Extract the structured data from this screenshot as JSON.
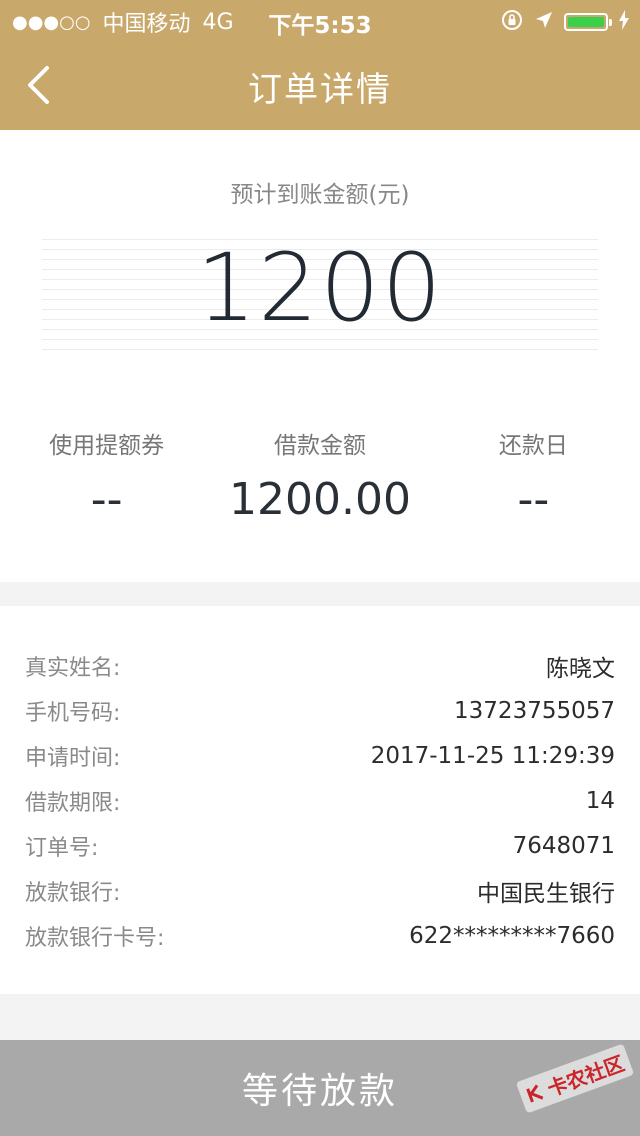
{
  "status_bar": {
    "signal_dots": "●●●○○",
    "carrier": "中国移动",
    "network": "4G",
    "time": "下午5:53",
    "battery_color": "#39d04a"
  },
  "navbar": {
    "title": "订单详情"
  },
  "summary": {
    "estimated_label": "预计到账金额(元)",
    "estimated_amount": "1200",
    "stats": [
      {
        "label": "使用提额券",
        "value": "--"
      },
      {
        "label": "借款金额",
        "value": "1200.00"
      },
      {
        "label": "还款日",
        "value": "--"
      }
    ]
  },
  "details": [
    {
      "key": "真实姓名:",
      "value": "陈晓文"
    },
    {
      "key": "手机号码:",
      "value": "13723755057"
    },
    {
      "key": "申请时间:",
      "value": "2017-11-25 11:29:39"
    },
    {
      "key": "借款期限:",
      "value": "14"
    },
    {
      "key": "订单号:",
      "value": "7648071"
    },
    {
      "key": "放款银行:",
      "value": "中国民生银行"
    },
    {
      "key": "放款银行卡号:",
      "value": "622*********7660"
    }
  ],
  "action": {
    "label": "等待放款"
  },
  "watermark": {
    "text": "卡农社区"
  },
  "colors": {
    "header": "#c9a86c",
    "button_disabled": "#a9a9a9"
  }
}
